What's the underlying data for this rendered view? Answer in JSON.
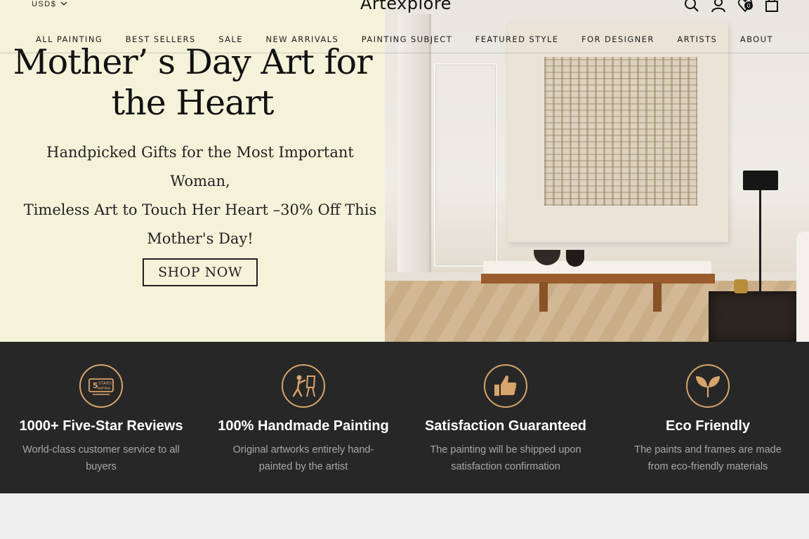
{
  "header": {
    "currency": "USD$",
    "logo": "Artexplore",
    "cart_count": "0"
  },
  "nav": {
    "items": [
      "ALL PAINTING",
      "BEST SELLERS",
      "SALE",
      "NEW ARRIVALS",
      "PAINTING SUBJECT",
      "FEATURED STYLE",
      "FOR DESIGNER",
      "ARTISTS",
      "ABOUT"
    ]
  },
  "hero": {
    "title_line1": "Mother’ s Day Art for",
    "title_line2": "the Heart",
    "sub_line1": "Handpicked Gifts for the Most Important Woman,",
    "sub_line2": "Timeless Art to Touch Her Heart –30% Off This",
    "sub_line3": "Mother's Day!",
    "cta": "SHOP NOW"
  },
  "features": [
    {
      "icon": "five-stars-rating-icon",
      "title": "1000+ Five-Star Reviews",
      "desc": "World-class customer service to all buyers"
    },
    {
      "icon": "painter-easel-icon",
      "title": "100% Handmade Painting",
      "desc": "Original artworks entirely hand-painted by the artist"
    },
    {
      "icon": "thumbs-up-icon",
      "title": "Satisfaction Guaranteed",
      "desc": "The painting will be shipped upon satisfaction confirmation"
    },
    {
      "icon": "leaf-icon",
      "title": "Eco Friendly",
      "desc": "The paints and frames are made from eco-friendly materials"
    }
  ],
  "colors": {
    "hero_bg": "#f4f3da",
    "features_bg": "#272727",
    "accent": "#d7a46b"
  }
}
